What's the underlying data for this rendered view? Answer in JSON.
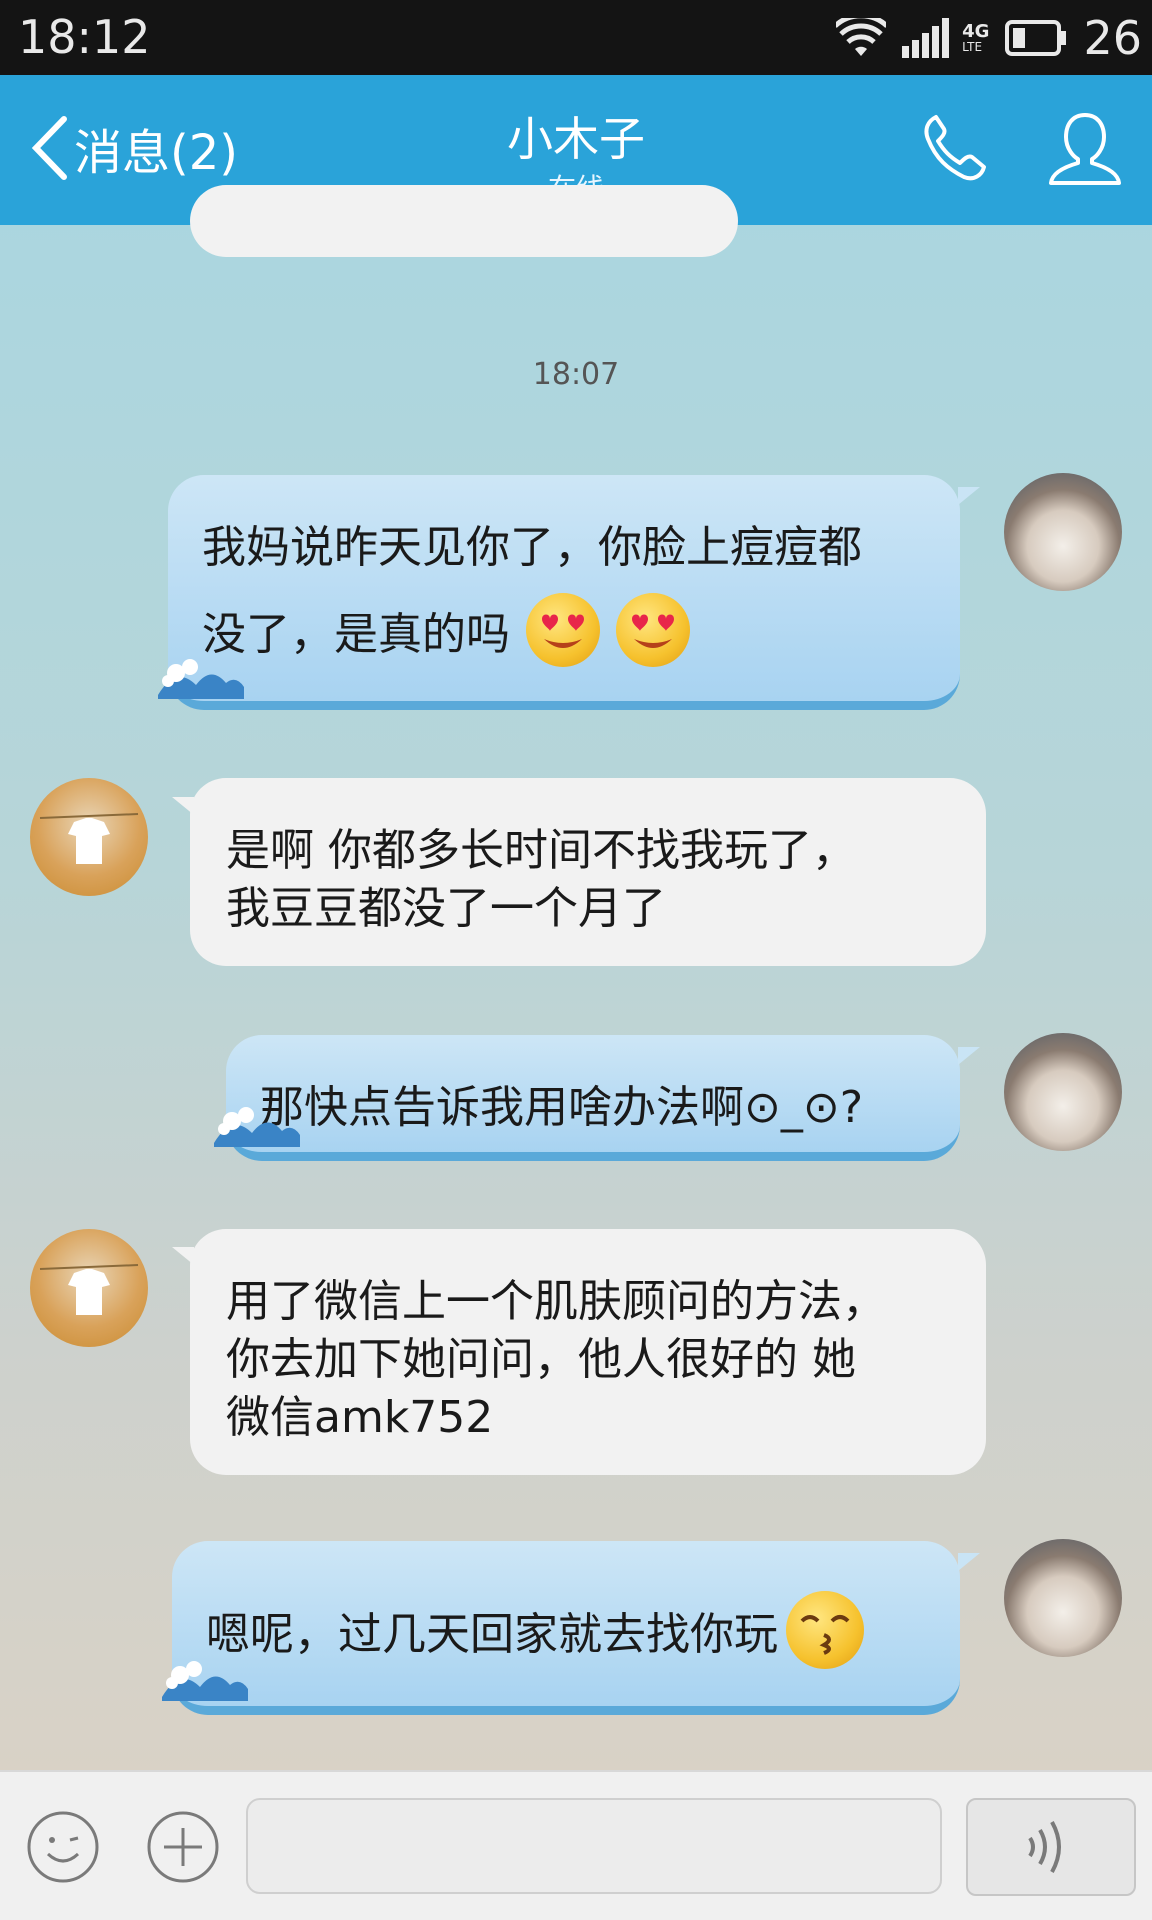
{
  "status_bar": {
    "time": "18:12",
    "network": "4G",
    "network_sub": "LTE",
    "battery": "26"
  },
  "header": {
    "back_label": "消息(2)",
    "contact_name": "小木子",
    "contact_status": "在线"
  },
  "chat": {
    "timestamp": "18:07",
    "messages": [
      {
        "sender": "me",
        "line1": "我妈说昨天见你了，你脸上痘痘都",
        "line2": "没了，是真的吗",
        "emojis": [
          "heart-eyes-emoji",
          "heart-eyes-emoji"
        ]
      },
      {
        "sender": "them",
        "line1": "是啊 你都多长时间不找我玩了，",
        "line2": "我豆豆都没了一个月了"
      },
      {
        "sender": "me",
        "line1": "那快点告诉我用啥办法啊⊙_⊙?"
      },
      {
        "sender": "them",
        "line1": "用了微信上一个肌肤顾问的方法，",
        "line2": "你去加下她问问，他人很好的 她",
        "line3": "微信amk752"
      },
      {
        "sender": "me",
        "line1": "嗯呢，过几天回家就去找你玩",
        "emojis": [
          "kissing-emoji"
        ]
      }
    ]
  },
  "colors": {
    "header": "#2aa3d9",
    "status_bar": "#141414",
    "my_bubble": "#a8d3f1",
    "their_bubble": "#f2f2f2"
  }
}
